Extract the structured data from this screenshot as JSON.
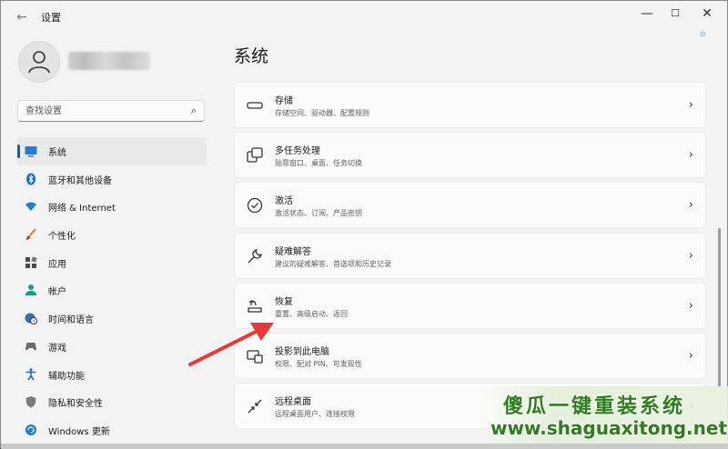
{
  "window": {
    "title": "设置"
  },
  "sidebar": {
    "search_placeholder": "查找设置",
    "items": [
      {
        "label": "系统",
        "icon": "monitor-icon",
        "active": true
      },
      {
        "label": "蓝牙和其他设备",
        "icon": "bluetooth-icon"
      },
      {
        "label": "网络 & Internet",
        "icon": "wifi-icon"
      },
      {
        "label": "个性化",
        "icon": "brush-icon"
      },
      {
        "label": "应用",
        "icon": "apps-icon"
      },
      {
        "label": "帐户",
        "icon": "account-icon"
      },
      {
        "label": "时间和语言",
        "icon": "globe-clock-icon"
      },
      {
        "label": "游戏",
        "icon": "gamepad-icon"
      },
      {
        "label": "辅助功能",
        "icon": "accessibility-icon"
      },
      {
        "label": "隐私和安全性",
        "icon": "shield-icon"
      },
      {
        "label": "Windows 更新",
        "icon": "windows-update-icon"
      }
    ]
  },
  "main": {
    "title": "系统",
    "cards": [
      {
        "title": "存储",
        "subtitle": "存储空间、驱动器、配置规则",
        "icon": "storage-icon"
      },
      {
        "title": "多任务处理",
        "subtitle": "贴靠窗口、桌面、任务切换",
        "icon": "multitask-icon"
      },
      {
        "title": "激活",
        "subtitle": "激活状态、订阅、产品密钥",
        "icon": "activation-icon"
      },
      {
        "title": "疑难解答",
        "subtitle": "建议的疑难解答、首选项和历史记录",
        "icon": "wrench-icon"
      },
      {
        "title": "恢复",
        "subtitle": "重置、高级启动、返回",
        "icon": "recovery-icon"
      },
      {
        "title": "投影到此电脑",
        "subtitle": "权限、配对 PIN、可发现性",
        "icon": "projection-icon"
      },
      {
        "title": "远程桌面",
        "subtitle": "远程桌面用户、连接权限",
        "icon": "remote-desktop-icon"
      }
    ]
  },
  "watermark": {
    "title": "傻瓜一键重装系统",
    "url": "www.shaguaxitong.net"
  },
  "colors": {
    "accent": "#0067c0",
    "annotation_arrow": "#e53935",
    "watermark": "#2e7d1e"
  }
}
